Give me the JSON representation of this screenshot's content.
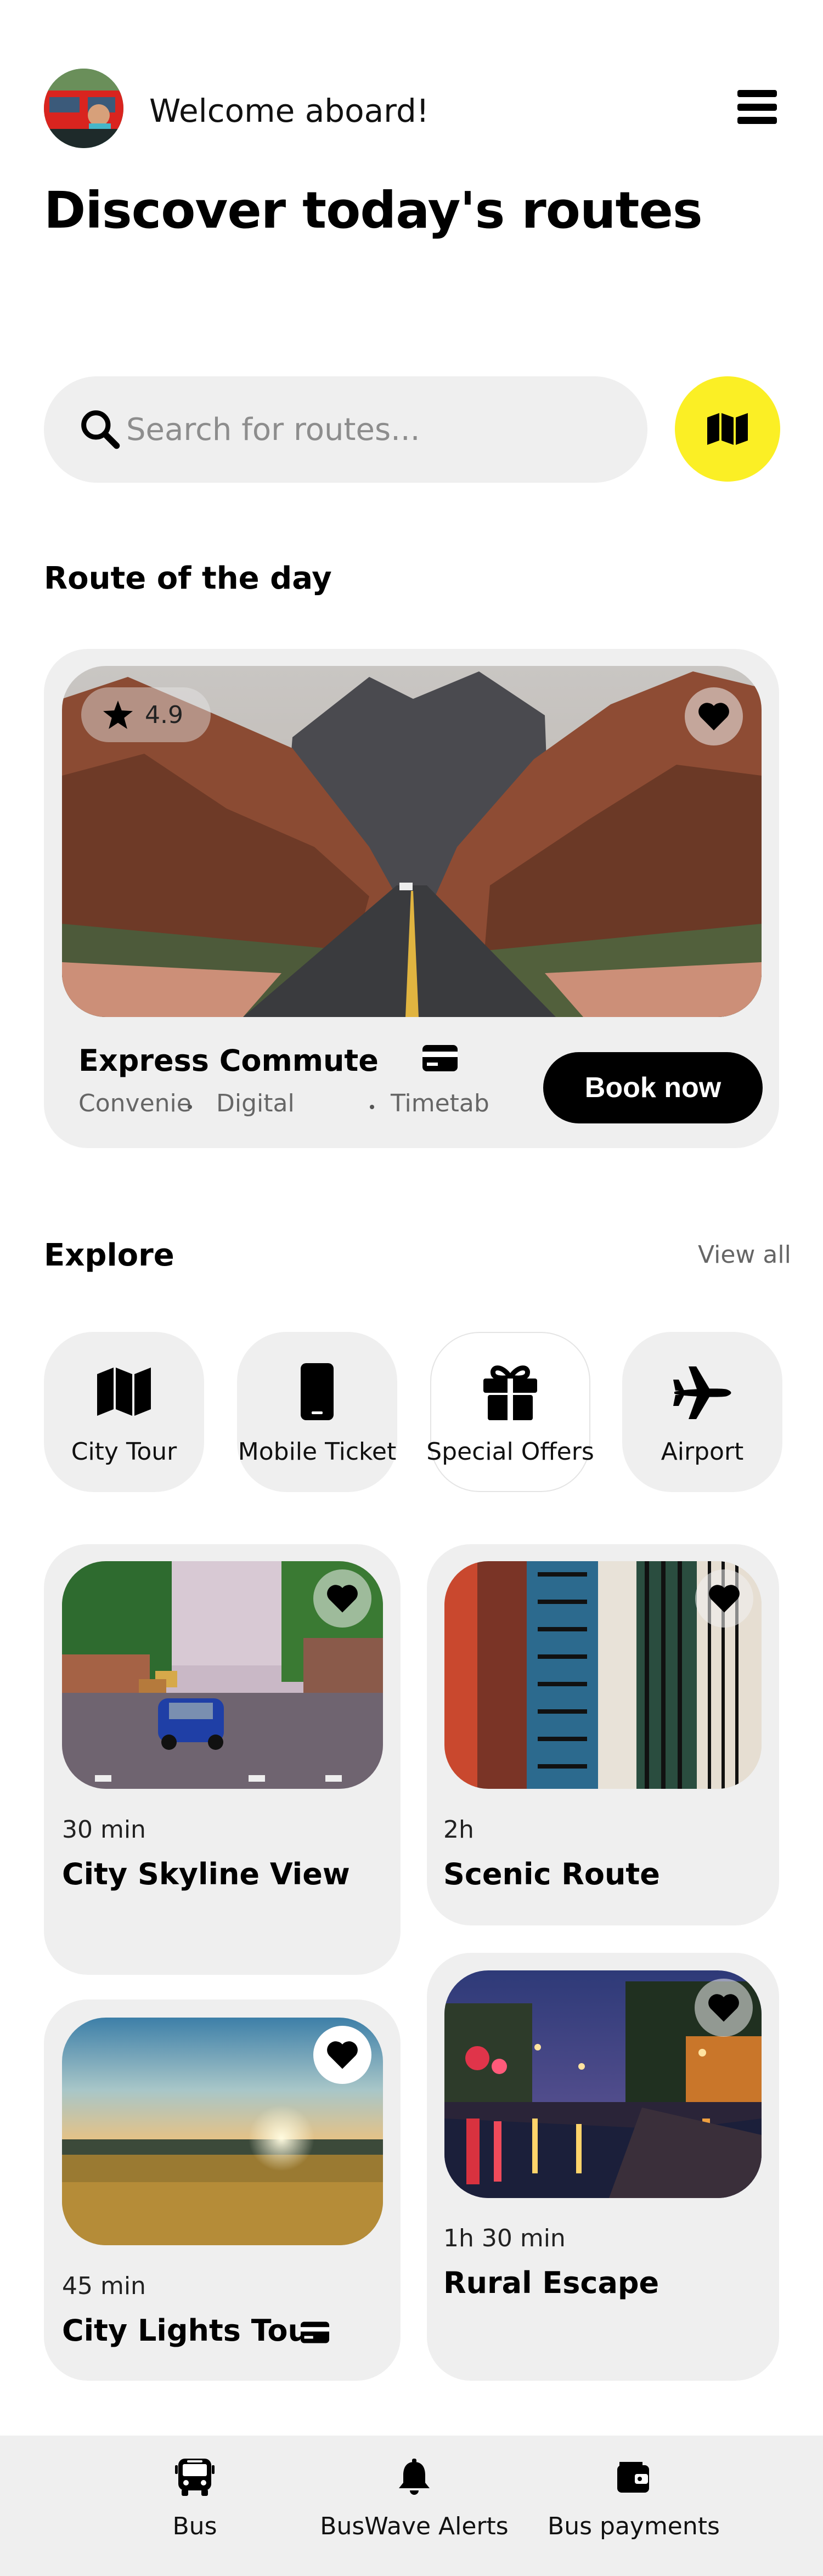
{
  "header": {
    "welcome": "Welcome aboard!",
    "title": "Discover today's routes"
  },
  "search": {
    "placeholder": "Search for routes..."
  },
  "route_of_day": {
    "section_title": "Route of the day",
    "rating": "4.9",
    "name": "Express Commute",
    "tags": [
      "Convenie",
      "Digital",
      "Timetab"
    ],
    "book_label": "Book now"
  },
  "explore": {
    "section_title": "Explore",
    "view_all": "View all",
    "categories": [
      {
        "label": "City Tour",
        "icon": "map-icon"
      },
      {
        "label": "Mobile Ticket",
        "icon": "mobile-icon"
      },
      {
        "label": "Special Offers",
        "icon": "gift-icon"
      },
      {
        "label": "Airport",
        "icon": "plane-icon"
      }
    ]
  },
  "tours": [
    {
      "time": "30 min",
      "title": "City Skyline View"
    },
    {
      "time": "2h",
      "title": "Scenic Route"
    },
    {
      "time": "45 min",
      "title": "City Lights Tour"
    },
    {
      "time": "1h 30 min",
      "title": "Rural Escape"
    }
  ],
  "bottom_nav": [
    {
      "label": "Bus",
      "icon": "bus-icon"
    },
    {
      "label": "BusWave Alerts",
      "icon": "bell-icon"
    },
    {
      "label": "Bus payments",
      "icon": "wallet-icon"
    }
  ],
  "colors": {
    "accent": "#fbef25",
    "card_bg": "#efefef",
    "primary": "#000000"
  }
}
